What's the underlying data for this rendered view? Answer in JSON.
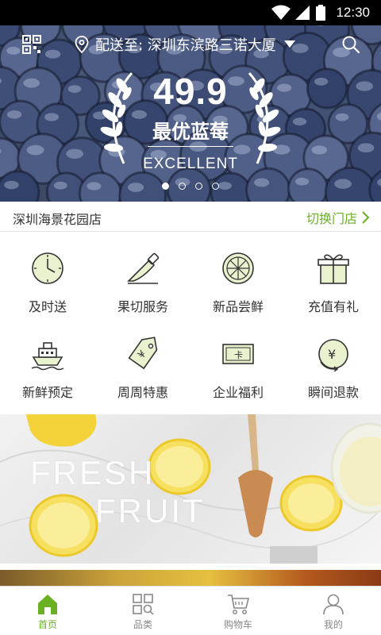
{
  "status_bar": {
    "time": "12:30"
  },
  "header": {
    "delivery_label": "配送至: 深圳东滨路三诺大厦"
  },
  "hero": {
    "price": "49.9",
    "product": "最优蓝莓",
    "tag": "EXCELLENT",
    "slide_count": 4,
    "active_slide": 1
  },
  "store": {
    "name": "深圳海景花园店",
    "switch_label": "切换门店"
  },
  "services": [
    {
      "label": "及时送",
      "icon": "clock-icon"
    },
    {
      "label": "果切服务",
      "icon": "knife-icon"
    },
    {
      "label": "新品尝鲜",
      "icon": "citrus-slice-icon"
    },
    {
      "label": "充值有礼",
      "icon": "gift-icon"
    },
    {
      "label": "新鲜预定",
      "icon": "ship-icon"
    },
    {
      "label": "周周特惠",
      "icon": "price-tag-icon"
    },
    {
      "label": "企业福利",
      "icon": "card-icon"
    },
    {
      "label": "瞬间退款",
      "icon": "refund-coin-icon"
    }
  ],
  "banner": {
    "line1": "FRESH",
    "line2": "FRUIT"
  },
  "tabbar": [
    {
      "label": "首页",
      "icon": "home-icon",
      "active": true
    },
    {
      "label": "品类",
      "icon": "category-icon",
      "active": false
    },
    {
      "label": "购物车",
      "icon": "cart-icon",
      "active": false
    },
    {
      "label": "我的",
      "icon": "profile-icon",
      "active": false
    }
  ],
  "colors": {
    "accent": "#6ab023",
    "icon_fill": "#e8f2cf",
    "icon_stroke": "#333333"
  }
}
